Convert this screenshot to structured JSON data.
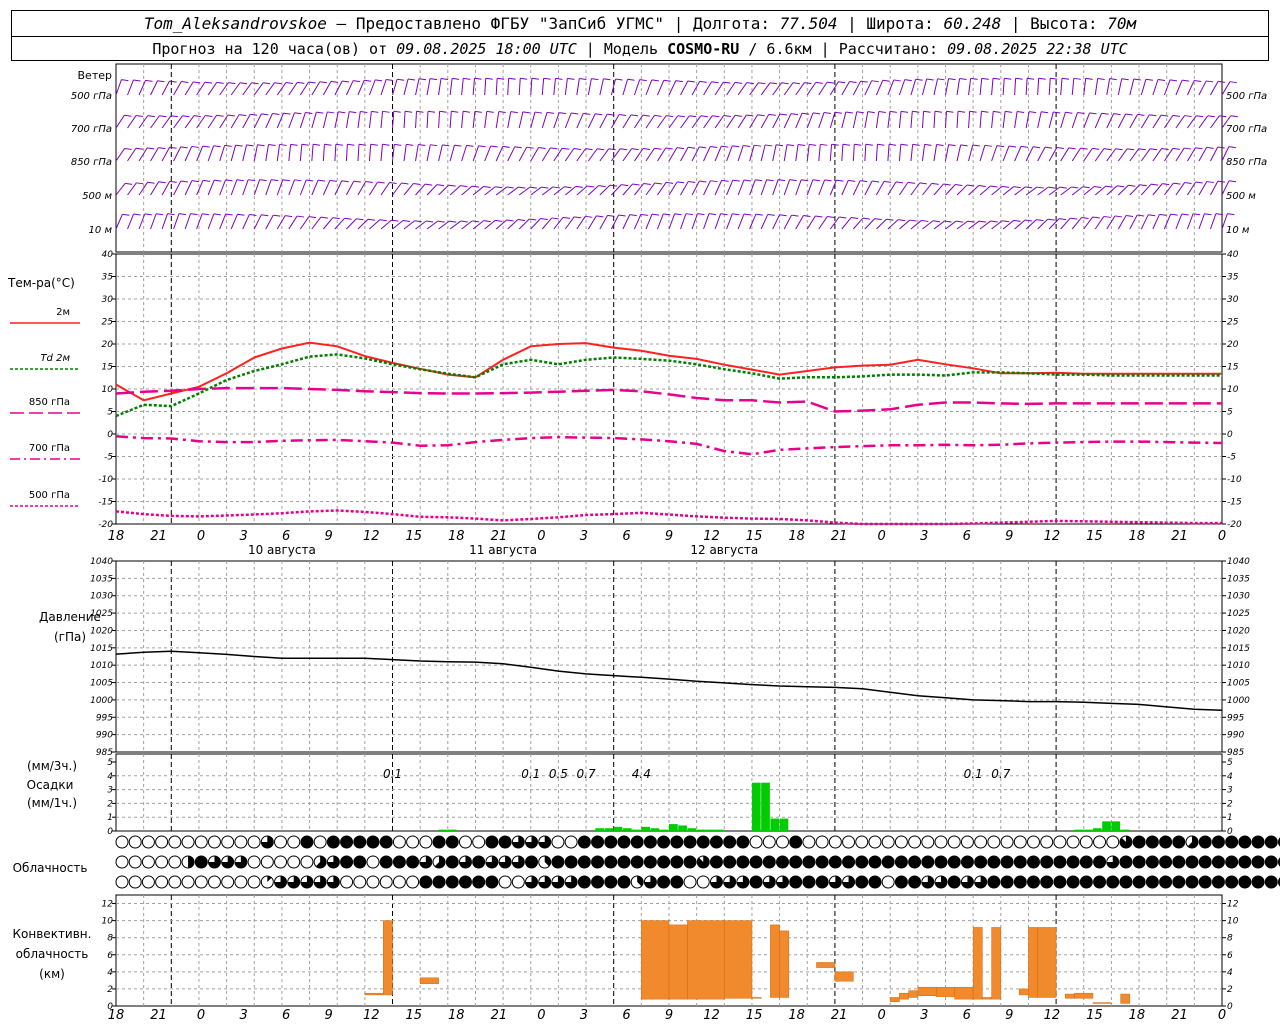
{
  "header": {
    "station": "Tom_Aleksandrovskoe",
    "dash": "—",
    "provider": "Предоставлено ФГБУ \"ЗапСиб УГМС\"",
    "lon_label": "Долгота:",
    "lon_value": "77.504",
    "lat_label": "Широта:",
    "lat_value": "60.248",
    "alt_label": "Высота:",
    "alt_value": "70м",
    "forecast_prefix": "Прогноз на 120 часа(ов)  от",
    "forecast_start": "09.08.2025 18:00 UTC",
    "model_label": "Модель",
    "model_name": "COSMO-RU",
    "model_res": "/ 6.6км",
    "calc_label": "Рассчитано:",
    "calc_time": "09.08.2025 22:38 UTC"
  },
  "colors": {
    "wind": "#8000c0",
    "t2m": "#ff2020",
    "td2m": "#008000",
    "isobaric": "#e8008c",
    "pressure": "#000000",
    "precip": "#00cc00",
    "convective": "#f08a2c",
    "grid": "#a0a0a0"
  },
  "wind_panel": {
    "title": "Ветер",
    "levels": [
      "500 гПа",
      "700 гПа",
      "850 гПа",
      "500 м",
      "10  м"
    ]
  },
  "x_axis": {
    "hour_labels": [
      "18",
      "21",
      "0",
      "3",
      "6",
      "9",
      "12",
      "15",
      "18",
      "21",
      "0",
      "3",
      "6",
      "9",
      "12",
      "15",
      "18",
      "21",
      "0",
      "3",
      "6",
      "9",
      "12",
      "15",
      "18",
      "21",
      "0"
    ],
    "day_labels": [
      "10 августа",
      "11 августа",
      "12 августа"
    ]
  },
  "temp_panel": {
    "title": "Тем-ра(°С)",
    "y_ticks": [
      40,
      35,
      30,
      25,
      20,
      15,
      10,
      5,
      0,
      -5,
      -10,
      -15,
      -20
    ],
    "legend": [
      {
        "label": "2м",
        "style": "solid",
        "color": "#ff2020"
      },
      {
        "label": "Td  2м",
        "style": "dotted",
        "color": "#008000"
      },
      {
        "label": "850 гПа",
        "style": "dashed",
        "color": "#e8008c"
      },
      {
        "label": "700 гПа",
        "style": "dashdot",
        "color": "#e8008c"
      },
      {
        "label": "500 гПа",
        "style": "dotted",
        "color": "#e8008c"
      }
    ]
  },
  "pressure_panel": {
    "title_line1": "Давление",
    "title_line2": "(гПа)",
    "y_ticks": [
      1040,
      1035,
      1030,
      1025,
      1020,
      1015,
      1010,
      1005,
      1000,
      995,
      990,
      985
    ]
  },
  "precip_panel": {
    "unit_top": "(мм/3ч.)",
    "title": "Осадки",
    "unit_bottom": "(мм/1ч.)",
    "y_ticks": [
      5,
      4,
      3,
      2,
      1,
      0
    ],
    "totals": [
      {
        "hour": 30,
        "text": "0.1"
      },
      {
        "hour": 45,
        "text": "0.1"
      },
      {
        "hour": 48,
        "text": "0.5"
      },
      {
        "hour": 51,
        "text": "0.7"
      },
      {
        "hour": 57,
        "text": "4.4"
      },
      {
        "hour": 93,
        "text": "0.1"
      },
      {
        "hour": 96,
        "text": "0.7"
      }
    ]
  },
  "cloud_panel": {
    "title": "Облачность",
    "rows": [
      "000000000006889899999888998899666889999999999999888900000000000000000000000079999599999999999",
      "000004966688888569989996596966693999999999997999999999999999999999999999999699999999999999999",
      "000000000001666668888889999998866669999369988666966999669989966966999999999999999999999999999"
    ]
  },
  "conv_panel": {
    "title_line1": "Конвективн.",
    "title_line2": "облачность",
    "title_line3": "(км)",
    "y_ticks": [
      12,
      10,
      8,
      6,
      4,
      2,
      0
    ]
  },
  "chart_data": [
    {
      "type": "line",
      "title": "Тем-ра(°С)",
      "x_unit": "hours from 09.08.2025 18:00 UTC",
      "ylim": [
        -20,
        40
      ],
      "x": [
        0,
        3,
        6,
        9,
        12,
        15,
        18,
        21,
        24,
        27,
        30,
        33,
        36,
        39,
        42,
        45,
        48,
        51,
        54,
        57,
        60,
        63,
        66,
        69,
        72,
        75,
        78,
        81,
        84,
        87,
        90,
        93,
        96,
        99,
        102,
        105,
        108,
        111,
        114,
        117,
        120
      ],
      "series": [
        {
          "name": "2м",
          "values": [
            11,
            7.5,
            9,
            10.5,
            13.5,
            17,
            19,
            20.3,
            19.5,
            17.3,
            15.8,
            14.5,
            13.2,
            12.6,
            16.5,
            19.5,
            20,
            20.2,
            19.2,
            18.5,
            17.4,
            16.7,
            15.4,
            14.3,
            13.2,
            14,
            14.8,
            15.2,
            15.4,
            16.5,
            15.5,
            14.6,
            13.5,
            13.5,
            13.6,
            13.4,
            13.4,
            13.4,
            13.4,
            13.4,
            13.4
          ]
        },
        {
          "name": "Td  2м",
          "values": [
            4,
            6.5,
            6.2,
            9,
            12,
            14,
            15.5,
            17.2,
            17.7,
            16.8,
            15.5,
            14.4,
            13.4,
            12.6,
            15.5,
            16.5,
            15.5,
            16.5,
            17,
            16.7,
            16.3,
            15.5,
            14.4,
            13.5,
            12.3,
            12.6,
            12.6,
            12.8,
            13.2,
            13.2,
            13,
            13.7,
            13.7,
            13.5,
            13.2,
            13.2,
            13,
            13,
            13,
            13,
            13
          ]
        },
        {
          "name": "850 гПа",
          "values": [
            9,
            9.4,
            9.6,
            10,
            10.2,
            10.2,
            10.2,
            10,
            9.8,
            9.5,
            9.3,
            9.1,
            9,
            9,
            9.1,
            9.2,
            9.4,
            9.6,
            9.8,
            9.5,
            8.8,
            8,
            7.5,
            7.5,
            7,
            7.2,
            5,
            5.2,
            5.5,
            6.5,
            7,
            7,
            6.8,
            6.7,
            6.8,
            6.8,
            6.8,
            6.8,
            6.8,
            6.8,
            6.8
          ]
        },
        {
          "name": "700 гПа",
          "values": [
            -0.5,
            -0.9,
            -1,
            -1.6,
            -1.8,
            -1.8,
            -1.5,
            -1.4,
            -1.3,
            -1.6,
            -1.9,
            -2.6,
            -2.5,
            -1.8,
            -1.3,
            -0.9,
            -0.7,
            -0.8,
            -0.9,
            -1.2,
            -1.6,
            -2.2,
            -3.8,
            -4.5,
            -3.5,
            -3.2,
            -2.9,
            -2.7,
            -2.5,
            -2.5,
            -2.4,
            -2.5,
            -2.4,
            -2.1,
            -1.9,
            -1.8,
            -1.7,
            -1.7,
            -1.8,
            -1.9,
            -2
          ]
        },
        {
          "name": "500 гПа",
          "values": [
            -17.2,
            -17.8,
            -18.2,
            -18.3,
            -18.1,
            -17.9,
            -17.6,
            -17.2,
            -17,
            -17.3,
            -17.8,
            -18.4,
            -18.5,
            -18.8,
            -19.2,
            -18.9,
            -18.5,
            -18,
            -17.8,
            -17.5,
            -17.9,
            -18.3,
            -18.6,
            -18.8,
            -18.9,
            -19.2,
            -19.7,
            -20.1,
            -20.2,
            -20.3,
            -20.1,
            -19.9,
            -19.7,
            -19.5,
            -19.3,
            -19.4,
            -19.5,
            -19.6,
            -19.7,
            -19.8,
            -19.8
          ]
        }
      ]
    },
    {
      "type": "line",
      "title": "Давление (гПа)",
      "ylim": [
        985,
        1040
      ],
      "x": [
        0,
        3,
        6,
        9,
        12,
        15,
        18,
        21,
        24,
        27,
        30,
        33,
        36,
        39,
        42,
        45,
        48,
        51,
        54,
        57,
        60,
        63,
        66,
        69,
        72,
        75,
        78,
        81,
        84,
        87,
        90,
        93,
        96,
        99,
        102,
        105,
        108,
        111,
        114,
        117,
        120
      ],
      "series": [
        {
          "name": "pressure",
          "values": [
            1013.2,
            1013.7,
            1014,
            1013.6,
            1013.1,
            1012.5,
            1012,
            1012,
            1012,
            1012,
            1011.6,
            1011.2,
            1011,
            1010.9,
            1010.4,
            1009.4,
            1008.3,
            1007.5,
            1007,
            1006.5,
            1006,
            1005.4,
            1004.9,
            1004.4,
            1004,
            1003.8,
            1003.6,
            1003.2,
            1002.2,
            1001.2,
            1000.6,
            1000,
            999.8,
            999.5,
            999.5,
            999.3,
            999,
            998.7,
            998,
            997.3,
            997
          ]
        }
      ]
    },
    {
      "type": "bar",
      "title": "Осадки (мм/1ч.)",
      "ylim": [
        0,
        5
      ],
      "x": [
        35,
        36,
        52,
        53,
        54,
        55,
        56,
        57,
        58,
        59,
        60,
        61,
        62,
        63,
        64,
        65,
        69,
        70,
        71,
        72,
        104,
        105,
        106,
        107,
        108,
        109
      ],
      "values": [
        0.1,
        0.1,
        0.2,
        0.2,
        0.3,
        0.2,
        0.1,
        0.3,
        0.2,
        0.1,
        0.5,
        0.4,
        0.2,
        0.1,
        0.1,
        0.1,
        3.5,
        3.5,
        0.9,
        0.9,
        0.1,
        0.1,
        0.2,
        0.7,
        0.7,
        0.1
      ]
    },
    {
      "type": "bar",
      "title": "Конвективн. облачность (км)",
      "ylim": [
        0,
        13
      ],
      "bars": [
        {
          "x0": 27,
          "x1": 29,
          "bottom": 1.3,
          "top": 1.5
        },
        {
          "x0": 29,
          "x1": 30,
          "bottom": 1.3,
          "top": 10
        },
        {
          "x0": 33,
          "x1": 35,
          "bottom": 2.6,
          "top": 3.3
        },
        {
          "x0": 57,
          "x1": 60,
          "bottom": 0.8,
          "top": 10
        },
        {
          "x0": 60,
          "x1": 62,
          "bottom": 0.8,
          "top": 9.5
        },
        {
          "x0": 62,
          "x1": 66,
          "bottom": 0.8,
          "top": 10
        },
        {
          "x0": 66,
          "x1": 69,
          "bottom": 0.9,
          "top": 10
        },
        {
          "x0": 69,
          "x1": 70,
          "bottom": 0.9,
          "top": 1
        },
        {
          "x0": 71,
          "x1": 72,
          "bottom": 1,
          "top": 9.5
        },
        {
          "x0": 72,
          "x1": 73,
          "bottom": 1,
          "top": 8.8
        },
        {
          "x0": 76,
          "x1": 78,
          "bottom": 4.5,
          "top": 5.1
        },
        {
          "x0": 78,
          "x1": 80,
          "bottom": 2.9,
          "top": 4
        },
        {
          "x0": 84,
          "x1": 85,
          "bottom": 0.5,
          "top": 1
        },
        {
          "x0": 85,
          "x1": 86,
          "bottom": 0.8,
          "top": 1.5
        },
        {
          "x0": 86,
          "x1": 87,
          "bottom": 1,
          "top": 1.8
        },
        {
          "x0": 87,
          "x1": 89,
          "bottom": 1.2,
          "top": 2.2
        },
        {
          "x0": 89,
          "x1": 91,
          "bottom": 1.1,
          "top": 2.2
        },
        {
          "x0": 91,
          "x1": 93,
          "bottom": 0.8,
          "top": 2.2
        },
        {
          "x0": 93,
          "x1": 94,
          "bottom": 0.8,
          "top": 9.2
        },
        {
          "x0": 94,
          "x1": 95,
          "bottom": 0.8,
          "top": 1
        },
        {
          "x0": 95,
          "x1": 96,
          "bottom": 0.8,
          "top": 9.2
        },
        {
          "x0": 98,
          "x1": 99,
          "bottom": 1.3,
          "top": 2
        },
        {
          "x0": 99,
          "x1": 100,
          "bottom": 1,
          "top": 9.2
        },
        {
          "x0": 100,
          "x1": 102,
          "bottom": 1,
          "top": 9.2
        },
        {
          "x0": 103,
          "x1": 104,
          "bottom": 0.9,
          "top": 1.4
        },
        {
          "x0": 104,
          "x1": 106,
          "bottom": 0.9,
          "top": 1.5
        },
        {
          "x0": 106,
          "x1": 108,
          "bottom": 0.3,
          "top": 0.4
        },
        {
          "x0": 109,
          "x1": 110,
          "bottom": 0.3,
          "top": 1.4
        }
      ]
    }
  ]
}
